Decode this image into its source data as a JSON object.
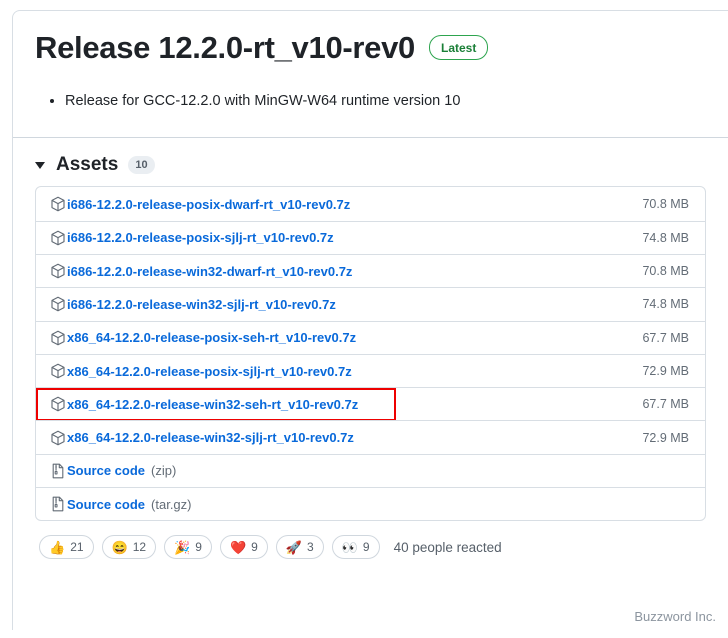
{
  "release": {
    "title": "Release 12.2.0-rt_v10-rev0",
    "badge": "Latest",
    "notes": [
      "Release for GCC-12.2.0 with MinGW-W64 runtime version 10"
    ]
  },
  "assets": {
    "heading": "Assets",
    "count": "10",
    "icons": {
      "package": "package-icon",
      "file_zip": "file-zip-icon",
      "disclosure": "triangle-down-icon"
    },
    "rows": [
      {
        "name": "i686-12.2.0-release-posix-dwarf-rt_v10-rev0.7z",
        "suffix": "",
        "size": "70.8 MB",
        "icon": "package-icon",
        "highlighted": false
      },
      {
        "name": "i686-12.2.0-release-posix-sjlj-rt_v10-rev0.7z",
        "suffix": "",
        "size": "74.8 MB",
        "icon": "package-icon",
        "highlighted": false
      },
      {
        "name": "i686-12.2.0-release-win32-dwarf-rt_v10-rev0.7z",
        "suffix": "",
        "size": "70.8 MB",
        "icon": "package-icon",
        "highlighted": false
      },
      {
        "name": "i686-12.2.0-release-win32-sjlj-rt_v10-rev0.7z",
        "suffix": "",
        "size": "74.8 MB",
        "icon": "package-icon",
        "highlighted": false
      },
      {
        "name": "x86_64-12.2.0-release-posix-seh-rt_v10-rev0.7z",
        "suffix": "",
        "size": "67.7 MB",
        "icon": "package-icon",
        "highlighted": false
      },
      {
        "name": "x86_64-12.2.0-release-posix-sjlj-rt_v10-rev0.7z",
        "suffix": "",
        "size": "72.9 MB",
        "icon": "package-icon",
        "highlighted": false
      },
      {
        "name": "x86_64-12.2.0-release-win32-seh-rt_v10-rev0.7z",
        "suffix": "",
        "size": "67.7 MB",
        "icon": "package-icon",
        "highlighted": true
      },
      {
        "name": "x86_64-12.2.0-release-win32-sjlj-rt_v10-rev0.7z",
        "suffix": "",
        "size": "72.9 MB",
        "icon": "package-icon",
        "highlighted": false
      },
      {
        "name": "Source code",
        "suffix": "(zip)",
        "size": "",
        "icon": "file-zip-icon",
        "highlighted": false
      },
      {
        "name": "Source code",
        "suffix": "(tar.gz)",
        "size": "",
        "icon": "file-zip-icon",
        "highlighted": false
      }
    ]
  },
  "reactions": {
    "items": [
      {
        "emoji": "👍",
        "name": "thumbs-up",
        "count": "21"
      },
      {
        "emoji": "😄",
        "name": "smile",
        "count": "12"
      },
      {
        "emoji": "🎉",
        "name": "tada",
        "count": "9"
      },
      {
        "emoji": "❤️",
        "name": "heart",
        "count": "9"
      },
      {
        "emoji": "🚀",
        "name": "rocket",
        "count": "3"
      },
      {
        "emoji": "👀",
        "name": "eyes",
        "count": "9"
      }
    ],
    "summary": "40 people reacted"
  },
  "watermark": "Buzzword Inc.",
  "colors": {
    "link": "#0969da",
    "badge_green": "#1a7f37",
    "highlight_red": "#ee0000",
    "muted": "#636c76"
  }
}
